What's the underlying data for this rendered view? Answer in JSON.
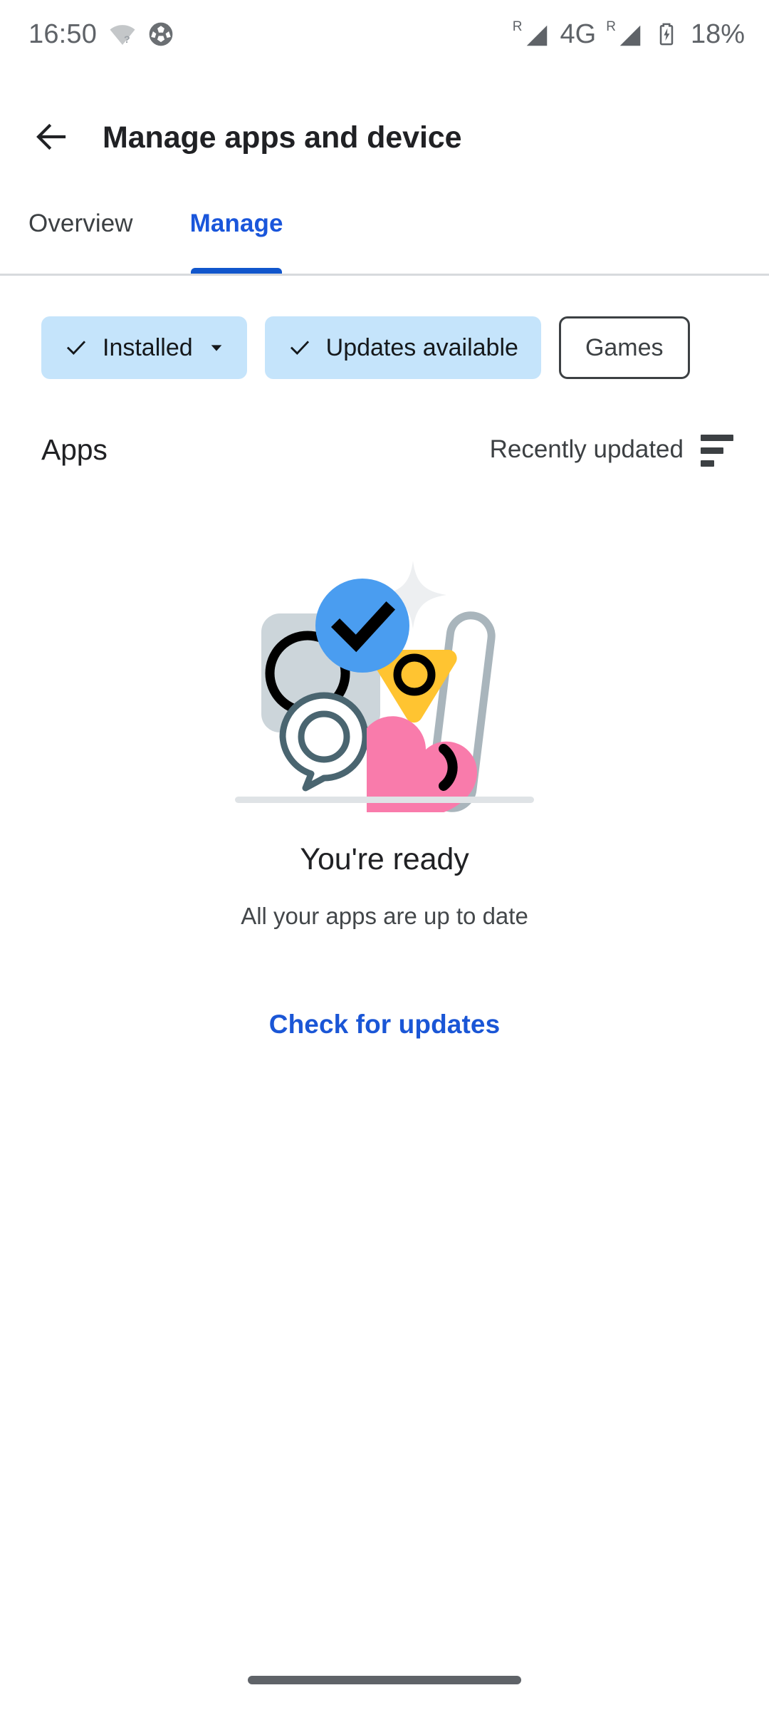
{
  "status_bar": {
    "time": "16:50",
    "network_type": "4G",
    "battery_percent": "18%",
    "roaming_indicator": "R",
    "icons": [
      "wifi-unknown-icon",
      "soccer-ball-icon",
      "signal-roaming-icon",
      "signal-roaming-icon-2",
      "battery-charging-icon"
    ]
  },
  "app_bar": {
    "back_icon": "arrow-back-icon",
    "title": "Manage apps and device"
  },
  "tabs": [
    {
      "label": "Overview",
      "active": false
    },
    {
      "label": "Manage",
      "active": true
    }
  ],
  "filter_chips": [
    {
      "label": "Installed",
      "selected": true,
      "has_check": true,
      "has_dropdown": true
    },
    {
      "label": "Updates available",
      "selected": true,
      "has_check": true,
      "has_dropdown": false
    },
    {
      "label": "Games",
      "selected": false,
      "has_check": false,
      "has_dropdown": false
    }
  ],
  "section": {
    "title": "Apps",
    "sort_label": "Recently updated",
    "sort_icon": "sort-icon"
  },
  "empty_state": {
    "illustration_name": "all-apps-up-to-date-illustration",
    "title": "You're ready",
    "subtitle": "All your apps are up to date",
    "action_label": "Check for updates"
  },
  "nav_bar": {
    "home_pill": "gesture-home-pill"
  },
  "colors": {
    "accent_blue": "#1a56d6",
    "tab_indicator": "#1156cc",
    "chip_selected_bg": "#c5e4fb",
    "chip_outline": "#3c4043",
    "status_text": "#5f6368",
    "illus_gray_square": "#ccd5da",
    "illus_blue_badge": "#4a9df0",
    "illus_yellow": "#ffc431",
    "illus_pink": "#f97bab",
    "illus_slate": "#4a6570",
    "illus_bar_gray": "#a9b5bc",
    "illus_sparkle": "#edeff1"
  }
}
